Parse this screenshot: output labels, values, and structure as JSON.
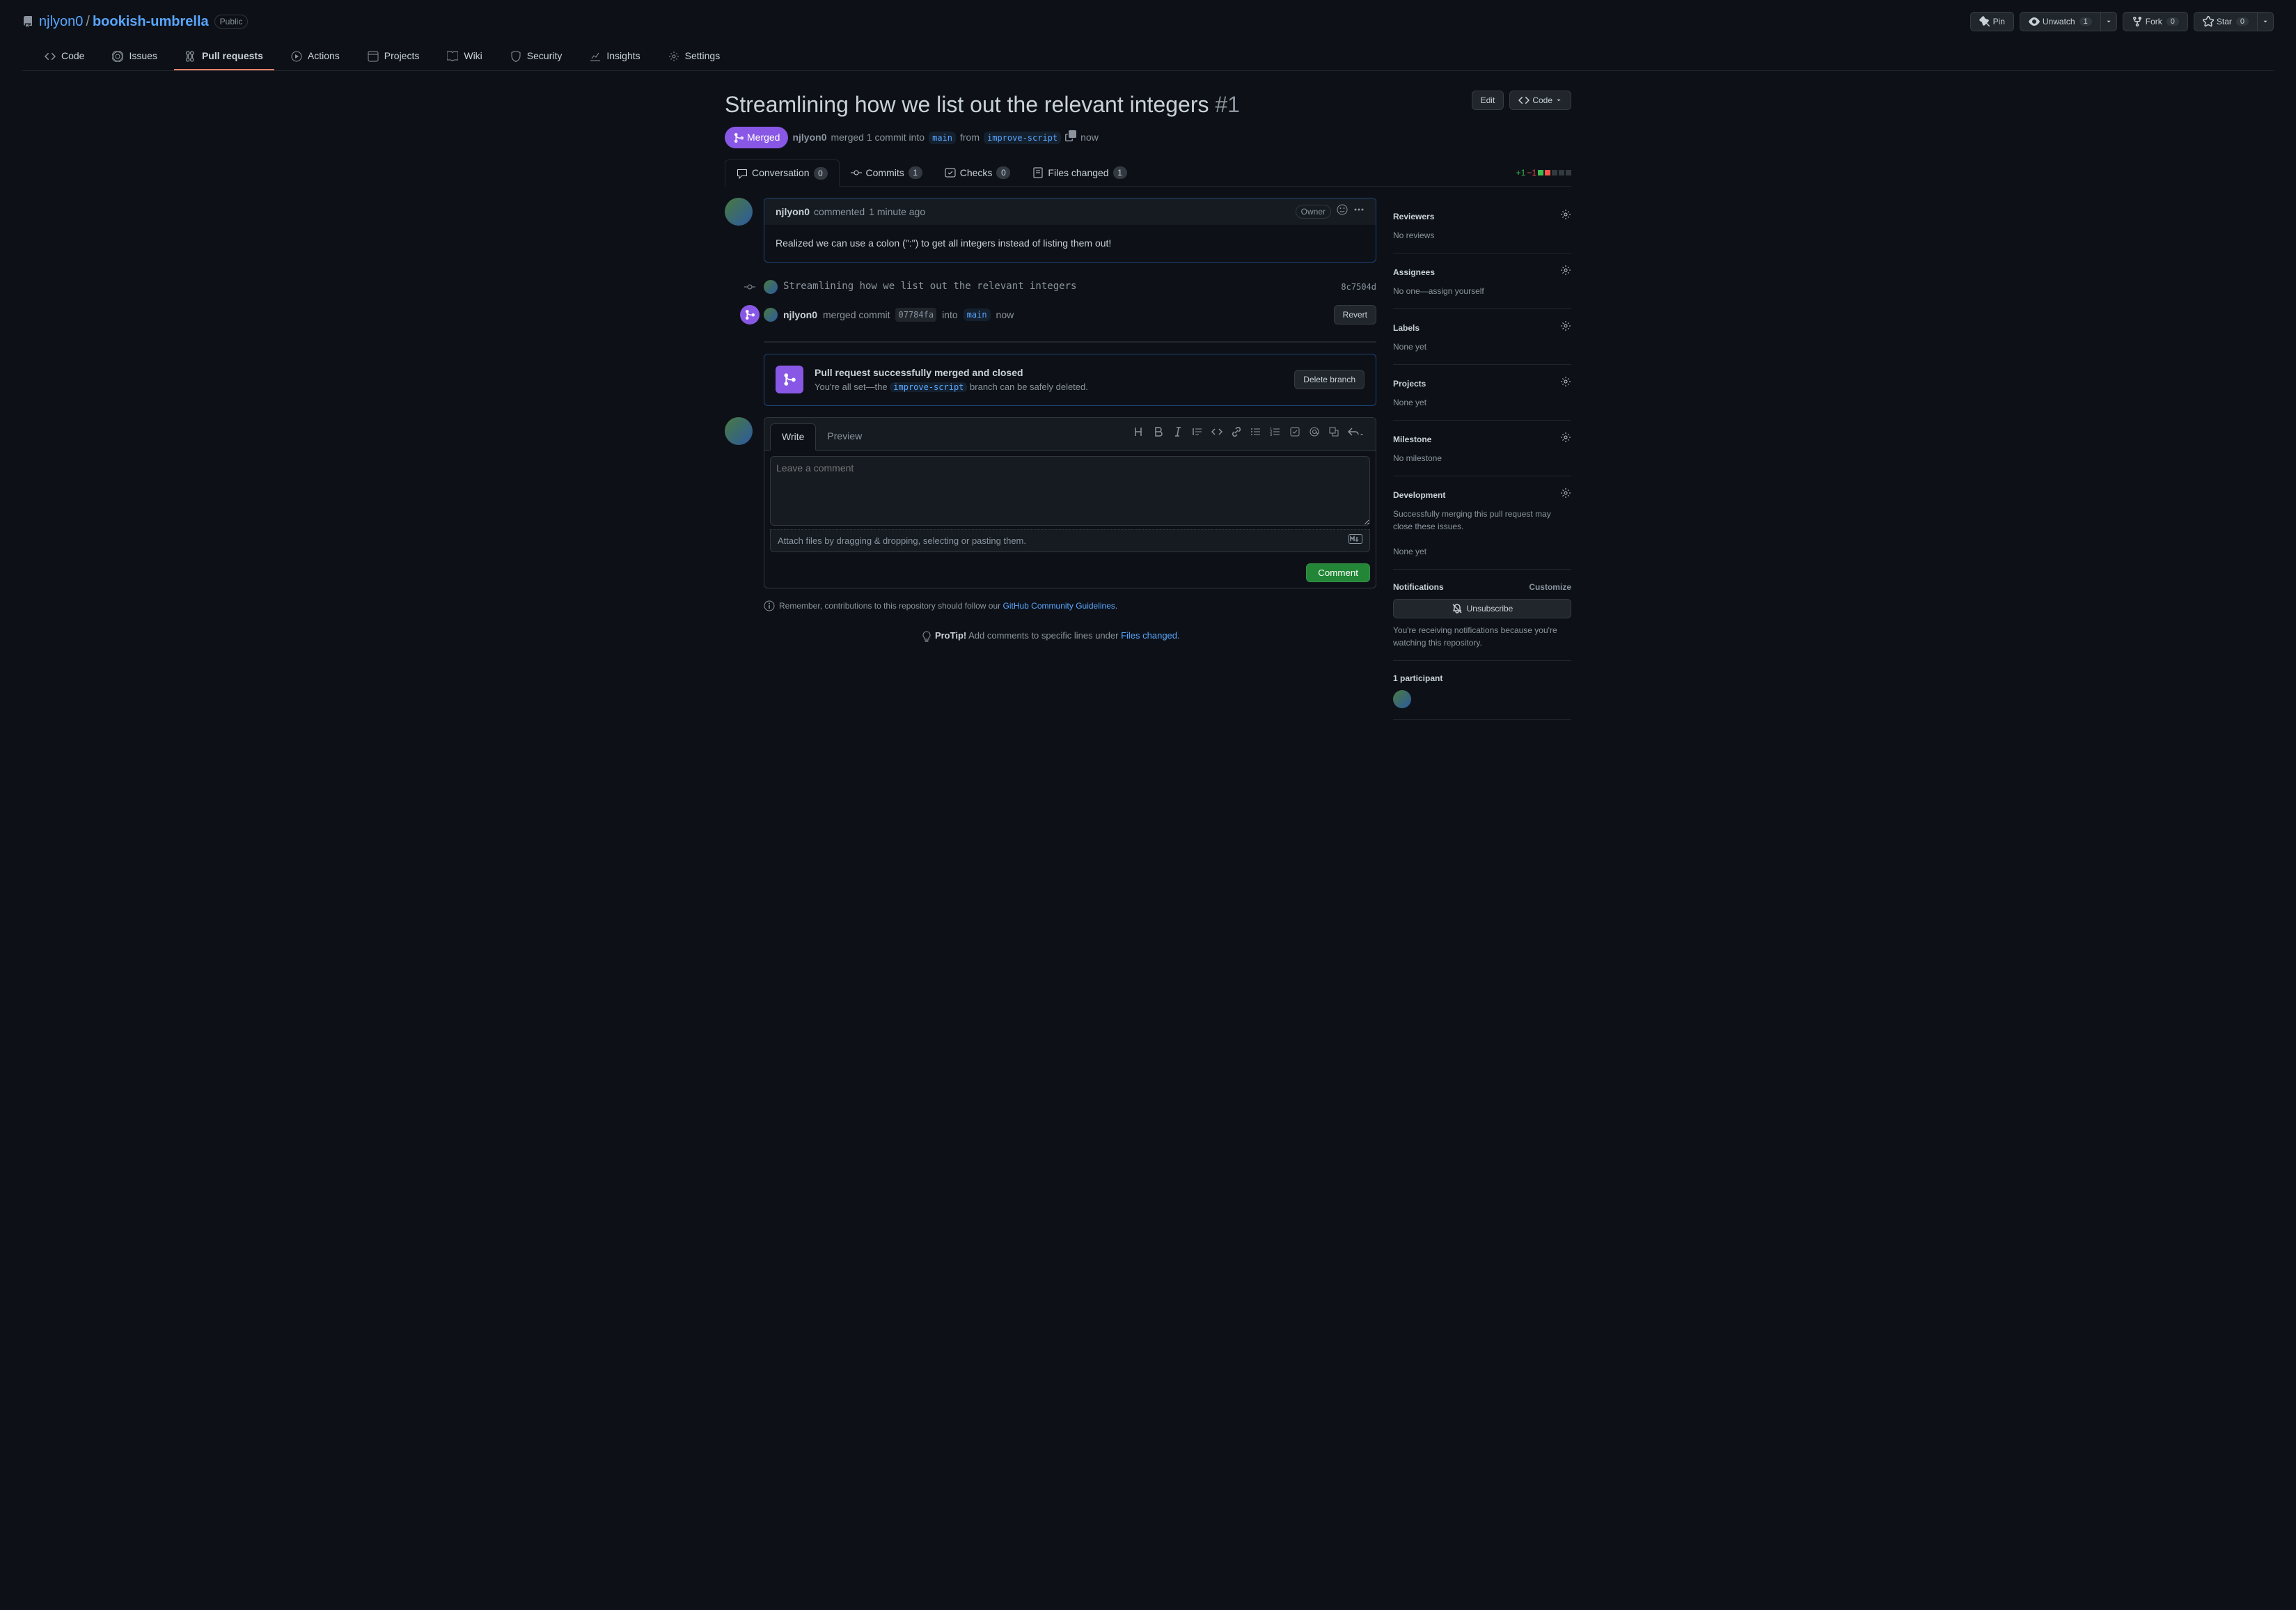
{
  "repo": {
    "owner": "njlyon0",
    "name": "bookish-umbrella",
    "visibility": "Public"
  },
  "repo_actions": {
    "pin": "Pin",
    "watch": "Unwatch",
    "watch_count": "1",
    "fork": "Fork",
    "fork_count": "0",
    "star": "Star",
    "star_count": "0"
  },
  "nav": {
    "code": "Code",
    "issues": "Issues",
    "pulls": "Pull requests",
    "actions": "Actions",
    "projects": "Projects",
    "wiki": "Wiki",
    "security": "Security",
    "insights": "Insights",
    "settings": "Settings"
  },
  "pr": {
    "title": "Streamlining how we list out the relevant integers",
    "number": "#1",
    "state": "Merged",
    "meta_author": "njlyon0",
    "meta_text1": "merged 1 commit into",
    "base_branch": "main",
    "meta_text2": "from",
    "head_branch": "improve-script",
    "meta_time": "now",
    "edit_btn": "Edit",
    "code_btn": "Code"
  },
  "pr_tabs": {
    "conversation": "Conversation",
    "conversation_count": "0",
    "commits": "Commits",
    "commits_count": "1",
    "checks": "Checks",
    "checks_count": "0",
    "files": "Files changed",
    "files_count": "1"
  },
  "diff": {
    "add": "+1",
    "del": "−1"
  },
  "comment": {
    "author": "njlyon0",
    "action": "commented",
    "time": "1 minute ago",
    "owner_badge": "Owner",
    "body": "Realized we can use a colon (\":\") to get all integers instead of listing them out!"
  },
  "commit_event": {
    "message": "Streamlining how we list out the relevant integers",
    "sha": "8c7504d"
  },
  "merge_event": {
    "author": "njlyon0",
    "text1": "merged commit",
    "sha": "07784fa",
    "text2": "into",
    "branch": "main",
    "time": "now",
    "revert": "Revert"
  },
  "merge_box": {
    "title": "Pull request successfully merged and closed",
    "sub1": "You're all set—the",
    "sub_branch": "improve-script",
    "sub2": "branch can be safely deleted.",
    "delete_btn": "Delete branch"
  },
  "editor": {
    "write_tab": "Write",
    "preview_tab": "Preview",
    "placeholder": "Leave a comment",
    "attach_hint": "Attach files by dragging & dropping, selecting or pasting them.",
    "comment_btn": "Comment"
  },
  "guidelines": {
    "text1": "Remember, contributions to this repository should follow our",
    "link": "GitHub Community Guidelines",
    "text2": "."
  },
  "protip": {
    "label": "ProTip!",
    "text": "Add comments to specific lines under",
    "link": "Files changed",
    "text2": "."
  },
  "sidebar": {
    "reviewers": {
      "title": "Reviewers",
      "body": "No reviews"
    },
    "assignees": {
      "title": "Assignees",
      "body_pre": "No one—",
      "body_link": "assign yourself"
    },
    "labels": {
      "title": "Labels",
      "body": "None yet"
    },
    "projects": {
      "title": "Projects",
      "body": "None yet"
    },
    "milestone": {
      "title": "Milestone",
      "body": "No milestone"
    },
    "development": {
      "title": "Development",
      "body": "Successfully merging this pull request may close these issues.",
      "body2": "None yet"
    },
    "notifications": {
      "title": "Notifications",
      "customize": "Customize",
      "unsubscribe": "Unsubscribe",
      "reason": "You're receiving notifications because you're watching this repository."
    },
    "participants": {
      "title": "1 participant"
    }
  }
}
